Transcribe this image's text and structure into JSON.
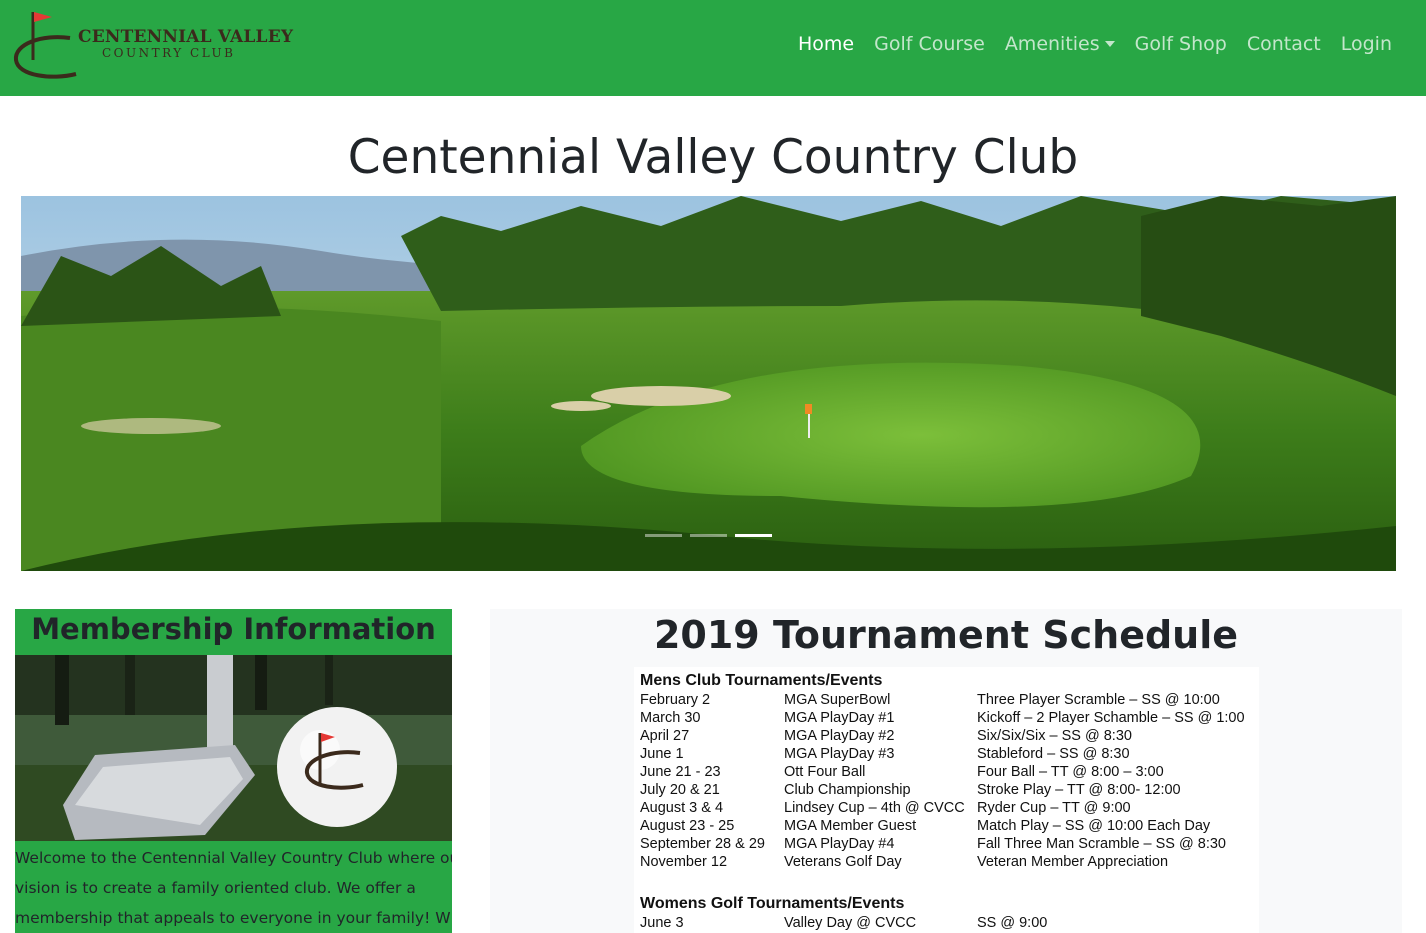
{
  "logo": {
    "line1": "CENTENNIAL VALLEY",
    "line2": "COUNTRY CLUB"
  },
  "nav": {
    "items": [
      {
        "label": "Home",
        "active": true
      },
      {
        "label": "Golf Course",
        "active": false
      },
      {
        "label": "Amenities",
        "active": false,
        "dropdown": true
      },
      {
        "label": "Golf Shop",
        "active": false
      },
      {
        "label": "Contact",
        "active": false
      },
      {
        "label": "Login",
        "active": false
      }
    ]
  },
  "page": {
    "title": "Centennial Valley Country Club"
  },
  "carousel": {
    "slide_count": 3,
    "active_index": 2
  },
  "membership": {
    "title": "Membership Information",
    "text_lines": [
      "Welcome to the Centennial Valley Country Club where our",
      "vision is to create a family oriented club. We offer a",
      "membership that appeals to everyone in your family! Whether"
    ]
  },
  "tournament": {
    "title": "2019 Tournament Schedule",
    "mens_heading": "Mens Club Tournaments/Events",
    "mens_rows": [
      [
        "February 2",
        "MGA SuperBowl",
        "Three Player Scramble – SS @ 10:00"
      ],
      [
        "March 30",
        "MGA PlayDay #1",
        "Kickoff – 2 Player Schamble – SS @ 1:00"
      ],
      [
        "April 27",
        "MGA PlayDay #2",
        "Six/Six/Six – SS @ 8:30"
      ],
      [
        "June 1",
        "MGA PlayDay #3",
        "Stableford – SS @ 8:30"
      ],
      [
        "June 21 - 23",
        "Ott Four Ball",
        "Four Ball – TT @ 8:00 – 3:00"
      ],
      [
        "July 20 & 21",
        "Club Championship",
        "Stroke Play – TT @ 8:00- 12:00"
      ],
      [
        "August 3 & 4",
        "Lindsey Cup – 4th @ CVCC",
        "Ryder Cup – TT @ 9:00"
      ],
      [
        "August 23 - 25",
        "MGA Member Guest",
        "Match Play – SS @ 10:00 Each Day"
      ],
      [
        "September 28 & 29",
        "MGA PlayDay #4",
        "Fall Three Man Scramble – SS @ 8:30"
      ],
      [
        "November 12",
        "Veterans Golf Day",
        "Veteran Member Appreciation"
      ]
    ],
    "womens_heading": "Womens Golf Tournaments/Events",
    "womens_rows": [
      [
        "June 3",
        "Valley Day @ CVCC",
        "SS @ 9:00"
      ]
    ]
  },
  "colors": {
    "brand_green": "#28a745",
    "text_dark": "#212529"
  }
}
